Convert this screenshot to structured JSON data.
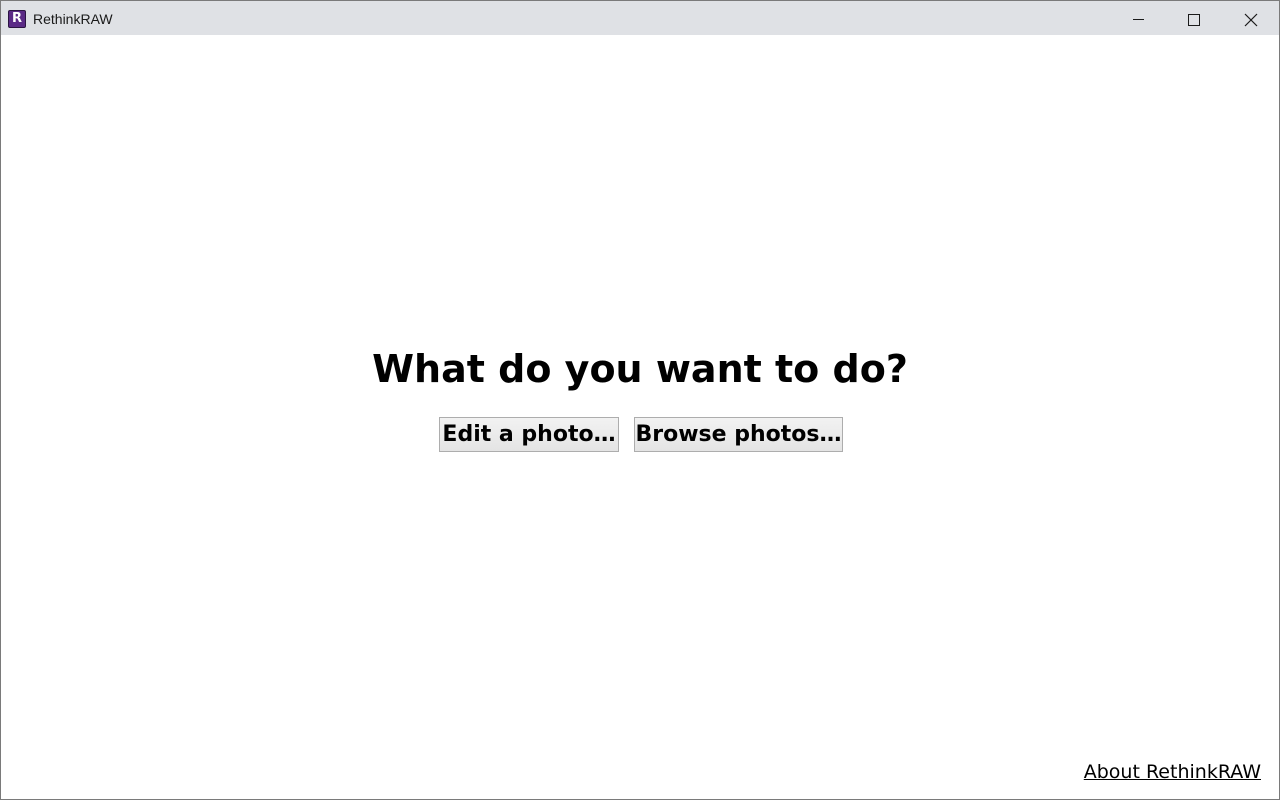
{
  "window": {
    "title": "RethinkRAW",
    "icon_letter": "R",
    "icon_name": "rethinkraw-app-icon",
    "controls": {
      "minimize": "minimize-icon",
      "maximize": "maximize-icon",
      "close": "close-icon"
    }
  },
  "main": {
    "heading": "What do you want to do?",
    "edit_button": "Edit a photo…",
    "browse_button": "Browse photos…",
    "about_link": "About RethinkRAW"
  },
  "colors": {
    "titlebar_bg": "#dfe1e5",
    "app_icon_bg": "#5b2a86",
    "page_bg": "#ffffff"
  }
}
